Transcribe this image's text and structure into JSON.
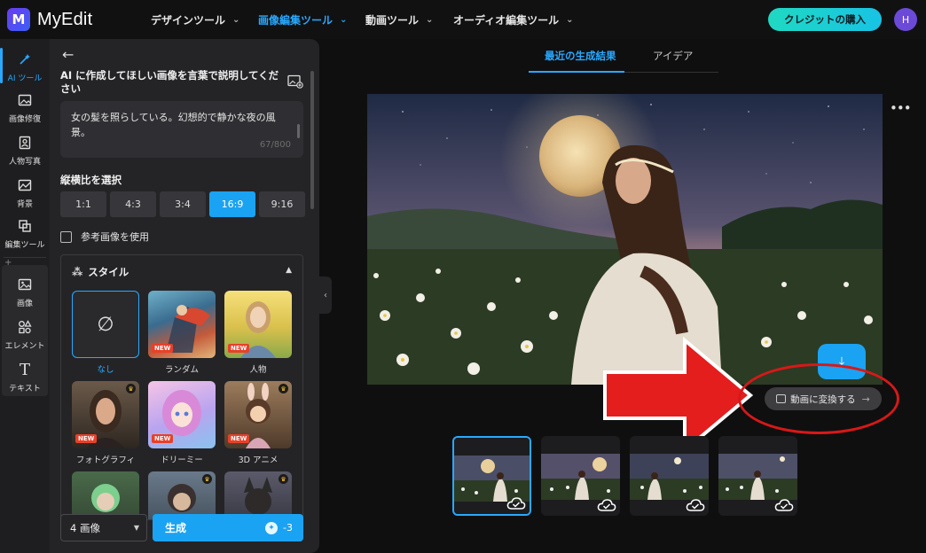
{
  "app": {
    "name": "MyEdit",
    "logo_letter": "M"
  },
  "nav": [
    {
      "label": "デザインツール",
      "active": false
    },
    {
      "label": "画像編集ツール",
      "active": true
    },
    {
      "label": "動画ツール",
      "active": false
    },
    {
      "label": "オーディオ編集ツール",
      "active": false
    }
  ],
  "header": {
    "buy_label": "クレジットの購入",
    "avatar_initial": "H"
  },
  "sidebar": {
    "items": [
      {
        "label": "AI ツール",
        "icon": "magic-wand-icon",
        "active": true
      },
      {
        "label": "画像修復",
        "icon": "image-repair-icon"
      },
      {
        "label": "人物写真",
        "icon": "portrait-icon"
      },
      {
        "label": "背景",
        "icon": "background-icon"
      },
      {
        "label": "編集ツール",
        "icon": "edit-tools-icon"
      },
      {
        "label": "画像",
        "icon": "image-icon"
      },
      {
        "label": "エレメント",
        "icon": "elements-icon"
      },
      {
        "label": "テキスト",
        "icon": "text-icon"
      }
    ]
  },
  "panel": {
    "prompt_title": "AI に作成してほしい画像を言葉で説明してください",
    "prompt_text": "女の髪を照らしている。幻想的で静かな夜の風景。",
    "counter": "67/800",
    "ratio_label": "縦横比を選択",
    "ratios": [
      "1:1",
      "4:3",
      "3:4",
      "16:9",
      "9:16"
    ],
    "selected_ratio": "16:9",
    "reference_label": "参考画像を使用",
    "style_label": "スタイル",
    "styles": [
      {
        "label": "なし",
        "selected": true,
        "badge": ""
      },
      {
        "label": "ランダム",
        "badge": "NEW"
      },
      {
        "label": "人物",
        "badge": "NEW"
      },
      {
        "label": "フォトグラフィ",
        "badge": "NEW"
      },
      {
        "label": "ドリーミー",
        "badge": "NEW"
      },
      {
        "label": "3D アニメ",
        "badge": "NEW"
      }
    ],
    "image_count": "4 画像",
    "generate_label": "生成",
    "generate_cost": "-3"
  },
  "results": {
    "tabs": [
      "最近の生成結果",
      "アイデア"
    ],
    "active_tab": "最近の生成結果",
    "convert_label": "動画に変換する",
    "thumb_count": 4
  },
  "colors": {
    "accent": "#1aa3f2",
    "annotation": "#d81818"
  }
}
